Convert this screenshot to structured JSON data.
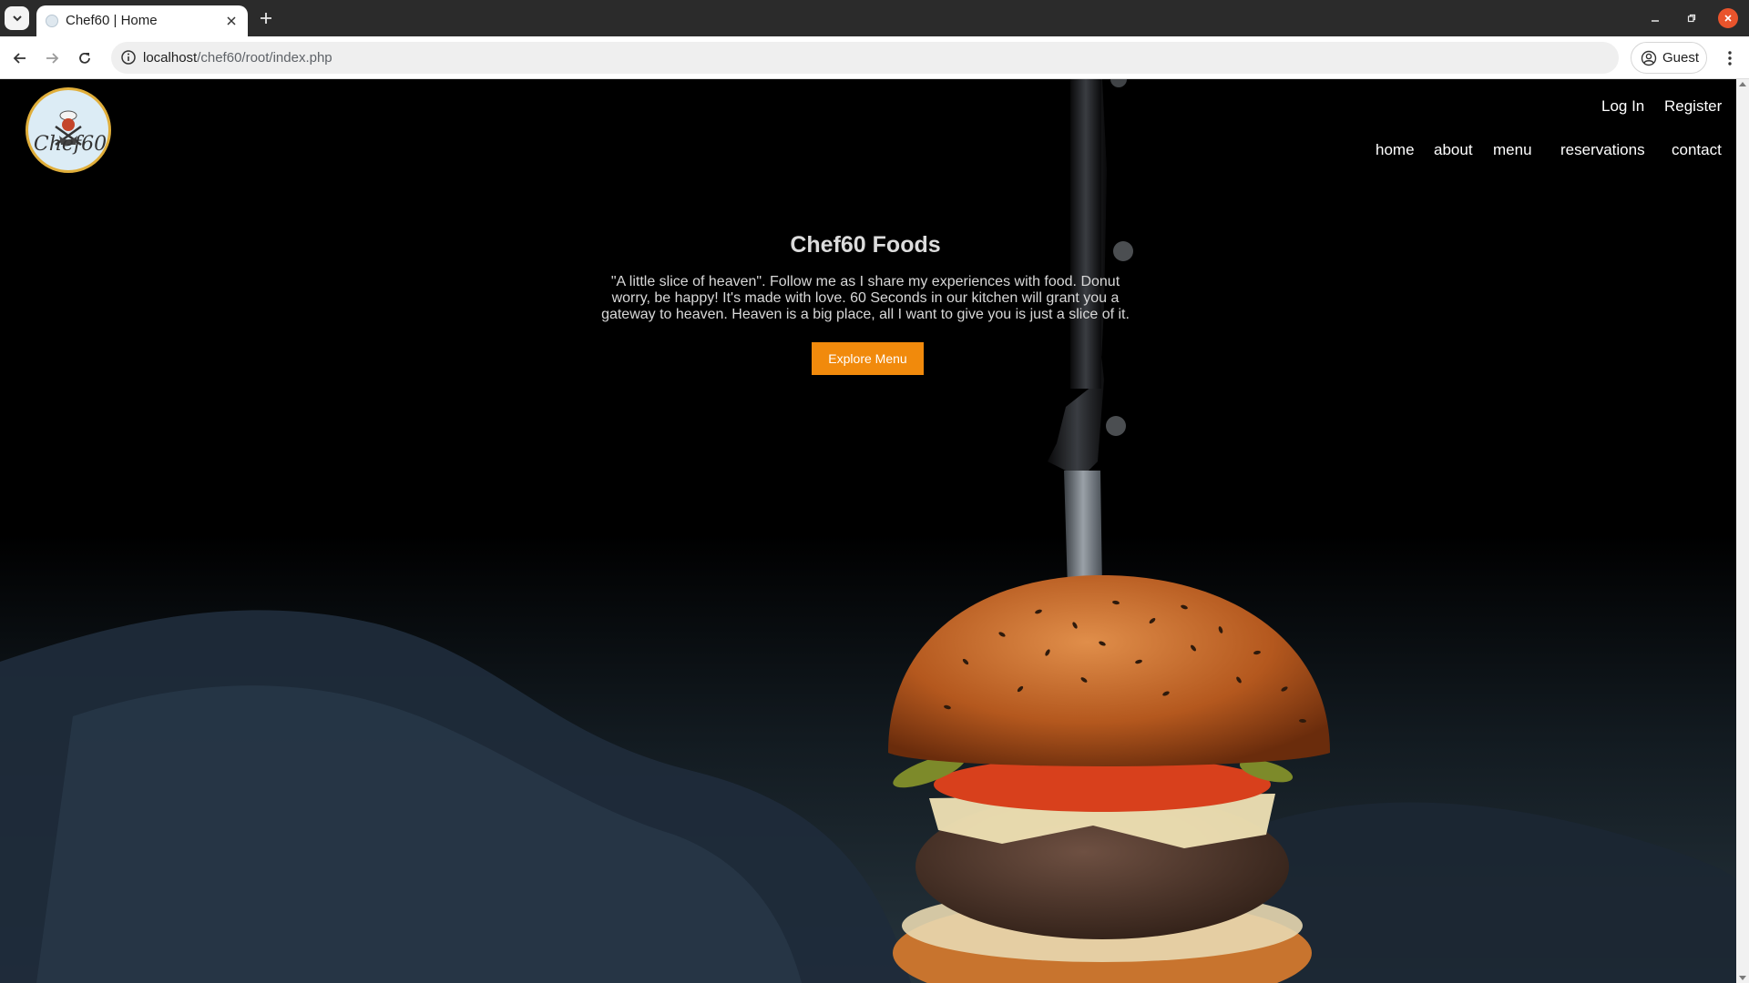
{
  "browser": {
    "tab": {
      "title": "Chef60 | Home"
    },
    "address": {
      "host": "localhost",
      "path": "/chef60/root/index.php"
    },
    "profile": {
      "label": "Guest"
    }
  },
  "site": {
    "logo_alt": "Chef60",
    "auth": {
      "login": "Log In",
      "register": "Register"
    },
    "nav": [
      "home",
      "about",
      "menu",
      "reservations",
      "contact"
    ],
    "hero": {
      "title": "Chef60 Foods",
      "text": "\"A little slice of heaven\". Follow me as I share my experiences with food. Donut worry, be happy! It's made with love. 60 Seconds in our kitchen will grant you a gateway to heaven. Heaven is a big place, all I want to give you is just a slice of it.",
      "cta": "Explore Menu"
    }
  },
  "colors": {
    "accent": "#f18a0c",
    "logo_ring": "#e0ae3a",
    "background": "#000000"
  }
}
